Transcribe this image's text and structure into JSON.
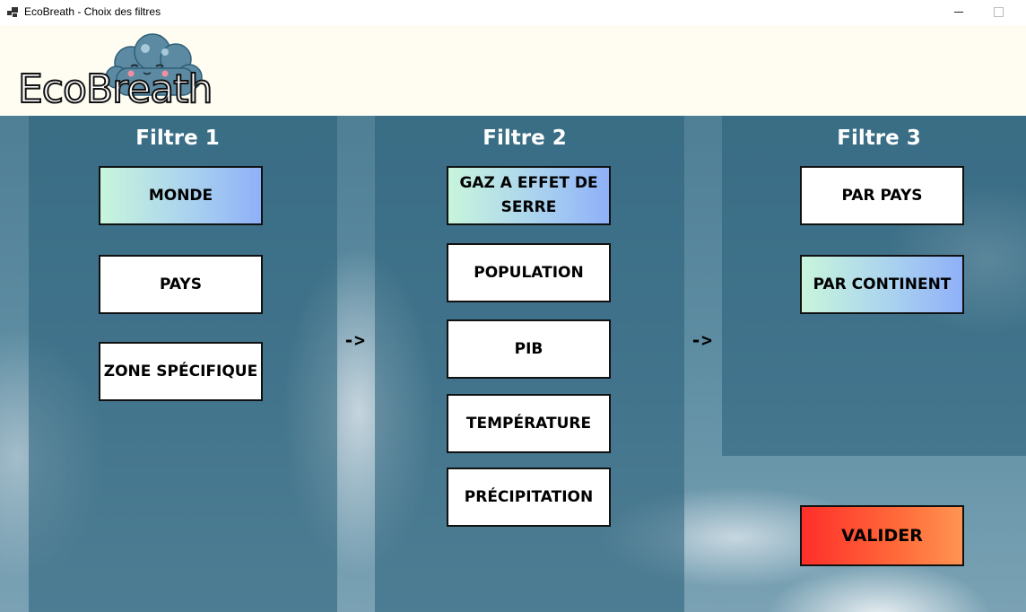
{
  "window": {
    "title": "EcoBreath - Choix des filtres"
  },
  "logo": {
    "text": "EcoBreath"
  },
  "filter1": {
    "title": "Filtre 1",
    "buttons": [
      "MONDE",
      "PAYS",
      "ZONE SPÉCIFIQUE"
    ],
    "selected": "MONDE"
  },
  "filter2": {
    "title": "Filtre 2",
    "buttons": [
      "GAZ A EFFET DE SERRE",
      "POPULATION",
      "PIB",
      "TEMPÉRATURE",
      "PRÉCIPITATION"
    ],
    "selected": "GAZ A EFFET DE SERRE"
  },
  "filter3": {
    "title": "Filtre 3",
    "buttons": [
      "PAR PAYS",
      "PAR CONTINENT"
    ],
    "selected": "PAR CONTINENT"
  },
  "arrows": [
    "->",
    "->"
  ],
  "validate": {
    "label": "VALIDER"
  },
  "colors": {
    "selected_gradient": [
      "#c8f5dc",
      "#8fb0f8"
    ],
    "validate_gradient": [
      "#ff2f2a",
      "#ff9452"
    ],
    "header_bg": "#fffdf1"
  }
}
